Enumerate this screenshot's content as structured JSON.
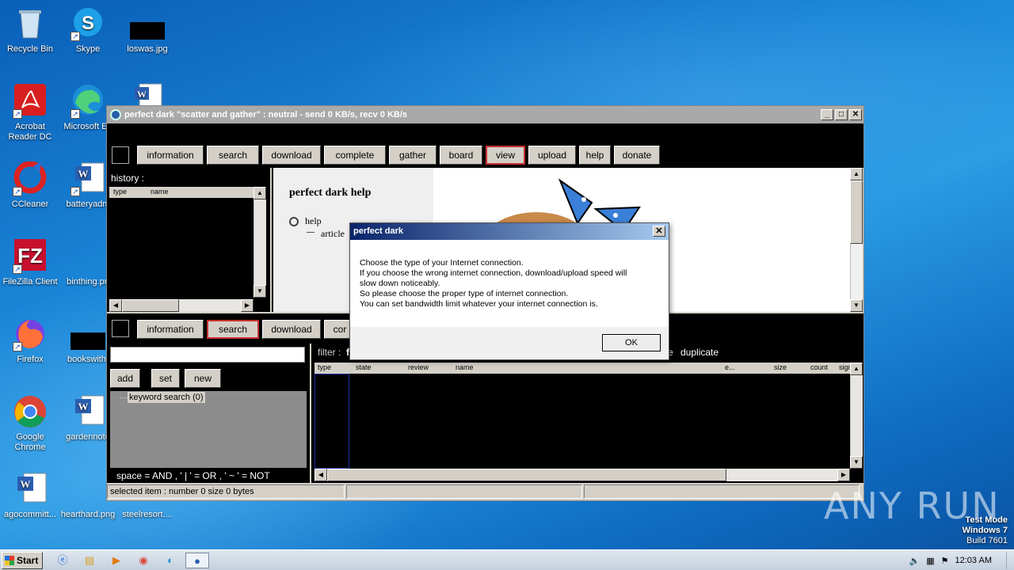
{
  "desktop": {
    "icons": [
      {
        "label": "Recycle Bin",
        "icon": "recycle-bin-icon"
      },
      {
        "label": "Skype",
        "icon": "skype-icon"
      },
      {
        "label": "loswas.jpg",
        "icon": "image-file-icon"
      },
      {
        "label": "Acrobat Reader DC",
        "icon": "acrobat-icon"
      },
      {
        "label": "Microsoft Ed",
        "icon": "edge-icon"
      },
      {
        "label": "CCleaner",
        "icon": "ccleaner-icon"
      },
      {
        "label": "batteryadm",
        "icon": "word-doc-icon"
      },
      {
        "label": "FileZilla Client",
        "icon": "filezilla-icon"
      },
      {
        "label": "binthing.pn",
        "icon": "image-file-icon"
      },
      {
        "label": "Firefox",
        "icon": "firefox-icon"
      },
      {
        "label": "bookswith.",
        "icon": "image-file-icon"
      },
      {
        "label": "Google Chrome",
        "icon": "chrome-icon"
      },
      {
        "label": "gardennote",
        "icon": "word-doc-icon"
      },
      {
        "label": "agocommitt...",
        "icon": "word-doc-icon"
      },
      {
        "label": "hearthard.png",
        "icon": "image-file-icon"
      },
      {
        "label": "steelresort....",
        "icon": "word-doc-icon"
      }
    ]
  },
  "window": {
    "title": "perfect dark \"scatter and gather\" : neutral - send   0 KB/s, recv   0 KB/s",
    "top_nav": [
      "information",
      "search",
      "download",
      "complete",
      "gather",
      "board",
      "view",
      "upload",
      "help",
      "donate"
    ],
    "top_active": "view",
    "history_label": "history :",
    "history_cols": [
      "type",
      "name"
    ],
    "help_title": "perfect dark help",
    "help_item": "help",
    "help_sub": "article",
    "bottom_nav": [
      "information",
      "search",
      "download",
      "cor"
    ],
    "bottom_active": "search",
    "search_input_value": "",
    "btn_add": "add",
    "btn_set": "set",
    "btn_new": "new",
    "tree_item": "keyword search (0)",
    "syntax_hint": "space = AND , ' | ' = OR , ' ~ ' = NOT",
    "filter_label": "filter :",
    "filter_partial": "fi",
    "filter_e": "e",
    "filter_duplicate": "duplicate",
    "result_cols": [
      "type",
      "state",
      "review",
      "name",
      "e...",
      "size",
      "count",
      "sign"
    ],
    "status_text": "selected item : number 0  size 0 bytes"
  },
  "dialog": {
    "title": "perfect dark",
    "lines": [
      "Choose the type of your Internet connection.",
      "If you choose the wrong internet connection, download/upload speed will",
      "slow down noticeably.",
      "So please choose the proper type of internet connection.",
      "You can set bandwidth limit whatever your internet connection is."
    ],
    "ok_label": "OK"
  },
  "taskbar": {
    "start_label": "Start",
    "clock": "12:03 AM"
  },
  "watermark": {
    "line1": "Test Mode",
    "line2": "Windows 7",
    "line3": "Build 7601",
    "brand": "ANY RUN"
  }
}
